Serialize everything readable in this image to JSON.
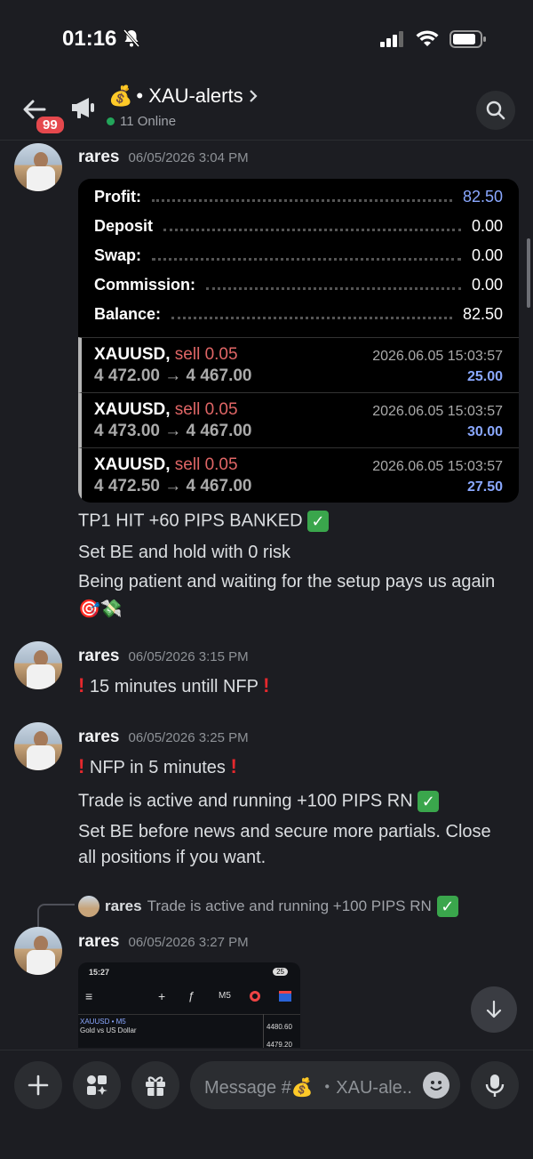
{
  "status_bar": {
    "time": "01:16",
    "battery_icon": "battery-icon",
    "wifi_icon": "wifi-icon"
  },
  "header": {
    "unread_badge": "99",
    "channel_emoji": "💰",
    "channel_name": "• XAU-alerts",
    "online_text": "11 Online"
  },
  "messages": [
    {
      "author": "rares",
      "timestamp": "06/05/2026 3:04 PM",
      "summary": [
        {
          "label": "Profit:",
          "value": "82.50"
        },
        {
          "label": "Deposit",
          "value": "0.00"
        },
        {
          "label": "Swap:",
          "value": "0.00"
        },
        {
          "label": "Commission:",
          "value": "0.00"
        },
        {
          "label": "Balance:",
          "value": "82.50"
        }
      ],
      "trades": [
        {
          "symbol": "XAUUSD,",
          "side": "sell 0.05",
          "prices": "4 472.00 → 4 467.00",
          "date": "2026.06.05 15:03:57",
          "pl": "25.00"
        },
        {
          "symbol": "XAUUSD,",
          "side": "sell 0.05",
          "prices": "4 473.00 → 4 467.00",
          "date": "2026.06.05 15:03:57",
          "pl": "30.00"
        },
        {
          "symbol": "XAUUSD,",
          "side": "sell 0.05",
          "prices": "4 472.50 → 4 467.00",
          "date": "2026.06.05 15:03:57",
          "pl": "27.50"
        }
      ],
      "lines": [
        "TP1 HIT +60 PIPS BANKED",
        "Set BE and hold with 0 risk",
        "Being patient and waiting for the setup pays us again",
        "🎯💸"
      ]
    },
    {
      "author": "rares",
      "timestamp": "06/05/2026 3:15 PM",
      "text": "15 minutes untill NFP"
    },
    {
      "author": "rares",
      "timestamp": "06/05/2026 3:25 PM",
      "text1": "NFP in 5 minutes",
      "text2": "Trade is active and running +100 PIPS RN",
      "text3": "Set BE before news and secure more partials. Close",
      "text4": "all positions if you want."
    },
    {
      "author": "rares",
      "timestamp": "06/05/2026 3:27 PM",
      "reply_author": "rares",
      "reply_text": "Trade is active and running +100 PIPS RN",
      "screenshot": {
        "time": "15:27",
        "battery": "25",
        "timeframe": "M5",
        "symbol": "XAUUSD • M5",
        "symbol_desc": "Gold vs US Dollar",
        "price1": "4480.60",
        "price2": "4479.20"
      }
    }
  ],
  "composer": {
    "placeholder": "Message #💰 ・XAU-ale.."
  }
}
